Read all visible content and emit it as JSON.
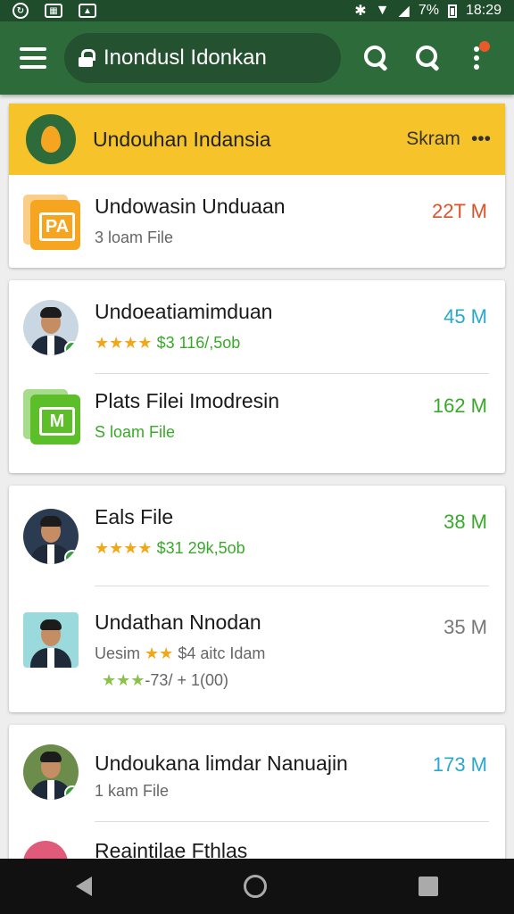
{
  "status": {
    "battery": "7%",
    "time": "18:29"
  },
  "appbar": {
    "search_text": "Inondusl Idonkan"
  },
  "header": {
    "title": "Undouhan Indansia",
    "action": "Skram",
    "more": "•••"
  },
  "rows": [
    {
      "title": "Undowasin Unduaan",
      "sub": "3 loam File",
      "size": "22T M",
      "size_color": "#d9532a",
      "icon": "folder-icon",
      "color": "#f6a521"
    },
    {
      "title": "Undoeatiamimduan",
      "stars": "★★★★",
      "sub": "$3 116/,5ob",
      "size": "45 M",
      "size_color": "#29a8c9",
      "icon": "avatar"
    },
    {
      "title": "Plats Filei Imodresin",
      "sub": "S loam File",
      "size": "162 M",
      "size_color": "#3aa82a",
      "icon": "image-file-icon",
      "color": "#5cbf2a"
    },
    {
      "title": "Eals File",
      "stars": "★★★★",
      "sub": "$31 29k,5ob",
      "size": "38 M",
      "size_color": "#3aa82a",
      "icon": "avatar"
    },
    {
      "title": "Undathan Nnodan",
      "sub_prefix": "Uesim",
      "stars": "★★",
      "sub": "$4 aitc Idam",
      "stars2": "★★★",
      "sub2": "-73/ + 1(00)",
      "size": "35 M",
      "size_color": "#777777",
      "icon": "avatar"
    },
    {
      "title": "Undoukana limdar Nanuajin",
      "sub": "1 kam File",
      "size": "173 M",
      "size_color": "#29a8c9",
      "icon": "avatar"
    },
    {
      "title": "Reaintilae Fthlas"
    }
  ]
}
